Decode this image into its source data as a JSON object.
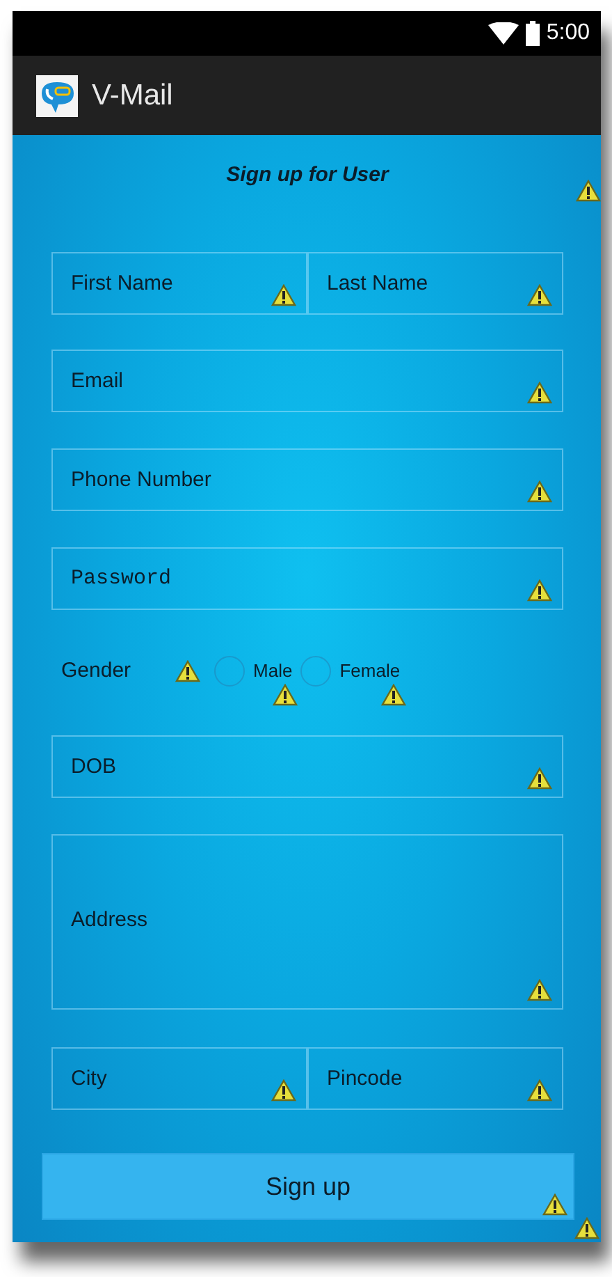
{
  "status_bar": {
    "time": "5:00"
  },
  "app_bar": {
    "title": "V-Mail"
  },
  "form": {
    "title": "Sign up for User",
    "title_warning": true,
    "rows": [
      {
        "kind": "fields",
        "fields": [
          {
            "kind": "text",
            "placeholder": "First Name",
            "warning": true
          },
          {
            "kind": "text",
            "placeholder": "Last Name",
            "warning": true
          }
        ]
      },
      {
        "kind": "fields",
        "fields": [
          {
            "kind": "text",
            "placeholder": "Email",
            "warning": true
          }
        ]
      },
      {
        "kind": "fields",
        "fields": [
          {
            "kind": "text",
            "placeholder": "Phone Number",
            "warning": true
          }
        ]
      },
      {
        "kind": "fields",
        "fields": [
          {
            "kind": "password",
            "placeholder": "Password",
            "warning": true
          }
        ]
      },
      {
        "kind": "radio",
        "label": "Gender",
        "warning": true,
        "options": [
          {
            "label": "Male",
            "selected": false,
            "warning": true
          },
          {
            "label": "Female",
            "selected": false,
            "warning": true
          }
        ]
      },
      {
        "kind": "fields",
        "fields": [
          {
            "kind": "text",
            "placeholder": "DOB",
            "warning": true
          }
        ]
      },
      {
        "kind": "fields",
        "fields": [
          {
            "kind": "multiline",
            "placeholder": "Address",
            "warning": true
          }
        ]
      },
      {
        "kind": "fields",
        "fields": [
          {
            "kind": "text",
            "placeholder": "City",
            "warning": true
          },
          {
            "kind": "text",
            "placeholder": "Pincode",
            "warning": true
          }
        ]
      }
    ],
    "submit_button": {
      "label": "Sign up",
      "warning": true
    },
    "screen_warning": true
  }
}
